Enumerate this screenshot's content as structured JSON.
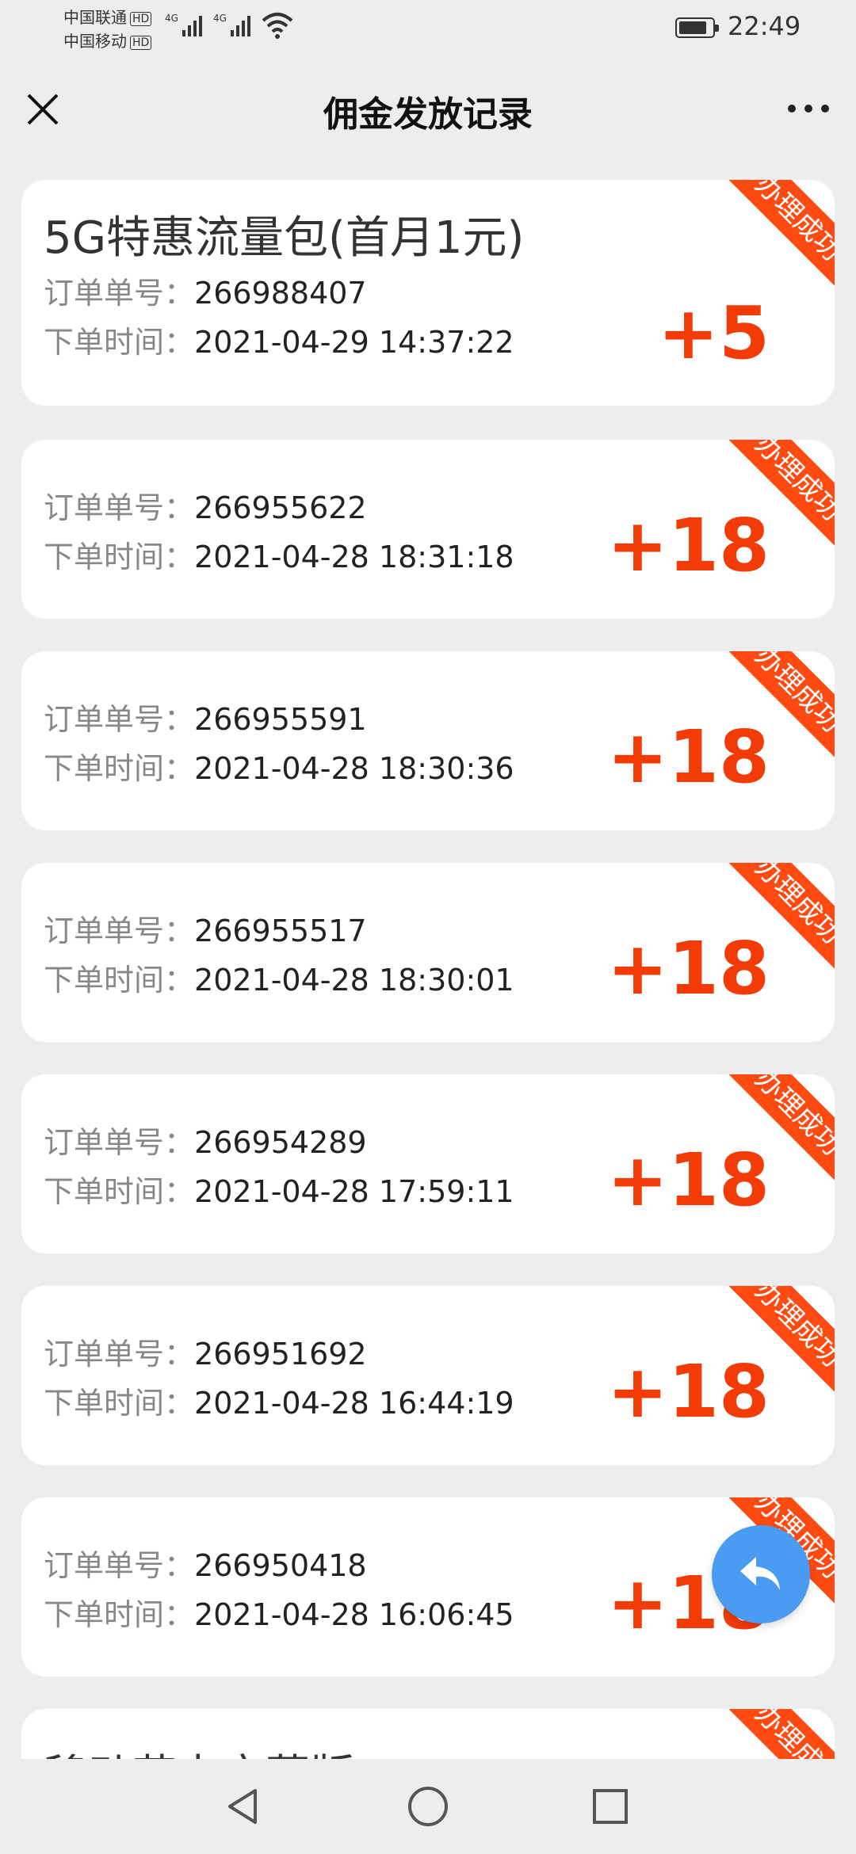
{
  "status_bar": {
    "carrier_1": "中国联通",
    "carrier_2": "中国移动",
    "hd_badge": "HD",
    "network_label": "4G",
    "time": "22:49"
  },
  "header": {
    "title": "佣金发放记录",
    "close_icon": "close-icon",
    "more_icon": "more-icon"
  },
  "labels": {
    "order_no": "订单单号：",
    "order_time": "下单时间：",
    "ribbon": "办理成功"
  },
  "records": [
    {
      "title": "5G特惠流量包(首月1元)",
      "order_no": "266988407",
      "time": "2021-04-29 14:37:22",
      "amount": "+5"
    },
    {
      "order_no": "266955622",
      "time": "2021-04-28 18:31:18",
      "amount": "+18"
    },
    {
      "order_no": "266955591",
      "time": "2021-04-28 18:30:36",
      "amount": "+18"
    },
    {
      "order_no": "266955517",
      "time": "2021-04-28 18:30:01",
      "amount": "+18"
    },
    {
      "order_no": "266954289",
      "time": "2021-04-28 17:59:11",
      "amount": "+18"
    },
    {
      "order_no": "266951692",
      "time": "2021-04-28 16:44:19",
      "amount": "+18"
    },
    {
      "order_no": "266950418",
      "time": "2021-04-28 16:06:45",
      "amount": "+18"
    }
  ],
  "partial_record_title": "移动花卡宝藏版",
  "colors": {
    "accent": "#ff4a12",
    "amount": "#f23b07",
    "fab": "#4a9bf2",
    "background": "#ededed"
  },
  "fab": {
    "icon": "reply-arrow-icon"
  },
  "nav_bar": {
    "icons": [
      "back-triangle-icon",
      "home-circle-icon",
      "recent-square-icon"
    ]
  }
}
